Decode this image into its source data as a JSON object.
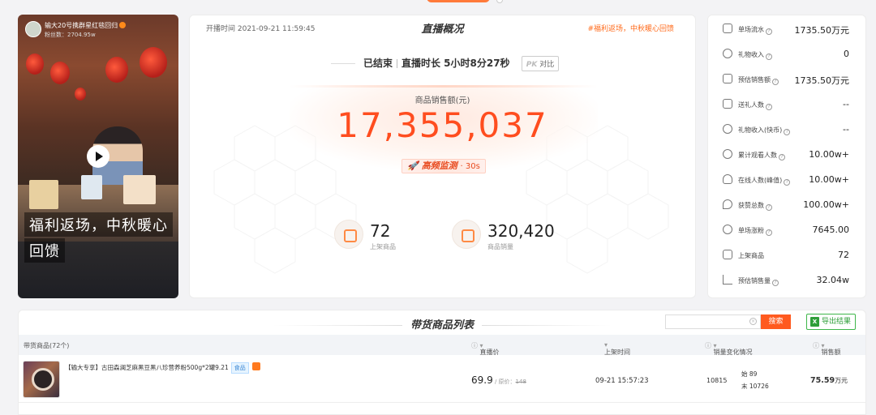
{
  "streamer": {
    "name": "输大20号携群星红毯回归",
    "fans": "粉丝数：2704.95w",
    "caption_line1": "福利返场，中秋暖心",
    "caption_line2": "回馈"
  },
  "overview": {
    "start_time": "开播时间 2021-09-21 11:59:45",
    "title": "直播概况",
    "tag": "#福利返场，中秋暖心回馈",
    "status": "已结束",
    "duration": "直播时长 5小时8分27秒",
    "pk_badge": "PK",
    "pk_label": "对比",
    "sale_label": "商品销售额(元)",
    "sale_value": "17,355,037",
    "monitor_label": "高频监测",
    "monitor_interval": "· 30s",
    "stats": [
      {
        "value": "72",
        "label": "上架商品"
      },
      {
        "value": "320,420",
        "label": "商品销量"
      }
    ]
  },
  "metrics": [
    {
      "icon": "cash-flow-icon",
      "label": "单场流水",
      "value": "1735.50万元"
    },
    {
      "icon": "gift-coins-icon",
      "label": "礼物收入",
      "value": "0"
    },
    {
      "icon": "estimated-sales-icon",
      "label": "预估销售额",
      "value": "1735.50万元"
    },
    {
      "icon": "gift-icon",
      "label": "送礼人数",
      "value": "--"
    },
    {
      "icon": "kuaibi-icon",
      "label": "礼物收入(快币)",
      "value": "--"
    },
    {
      "icon": "play-circle-icon",
      "label": "累计观看人数",
      "value": "10.00w+"
    },
    {
      "icon": "online-users-icon",
      "label": "在线人数(峰值)",
      "value": "10.00w+"
    },
    {
      "icon": "heart-icon",
      "label": "获赞总数",
      "value": "100.00w+"
    },
    {
      "icon": "follower-gain-icon",
      "label": "单场涨粉",
      "value": "7645.00"
    },
    {
      "icon": "shelf-icon",
      "label": "上架商品",
      "value": "72"
    },
    {
      "icon": "bar-chart-icon",
      "label": "预估销售量",
      "value": "32.04w"
    }
  ],
  "product_list": {
    "title": "带货商品列表",
    "search_placeholder": "",
    "search_button": "搜索",
    "export_button": "导出结果",
    "columns": {
      "product": "带货商品(72个)",
      "price": "直播价",
      "listed_time": "上架时间",
      "sales_change": "销量变化情况",
      "sales_amount": "销售额"
    },
    "rows": [
      {
        "name": "【输大专享】古田森澜芝麻黑豆黑八珍营养粉500g*2罐9.21",
        "tag": "食品",
        "price": "69.9",
        "orig_label": " / 原价：",
        "orig_price": "148",
        "listed_time": "09-21 15:57:23",
        "change": "10815",
        "start_stock": "始 89",
        "end_stock": "末 10726",
        "sales": "75.59",
        "sales_unit": "万元"
      }
    ]
  }
}
